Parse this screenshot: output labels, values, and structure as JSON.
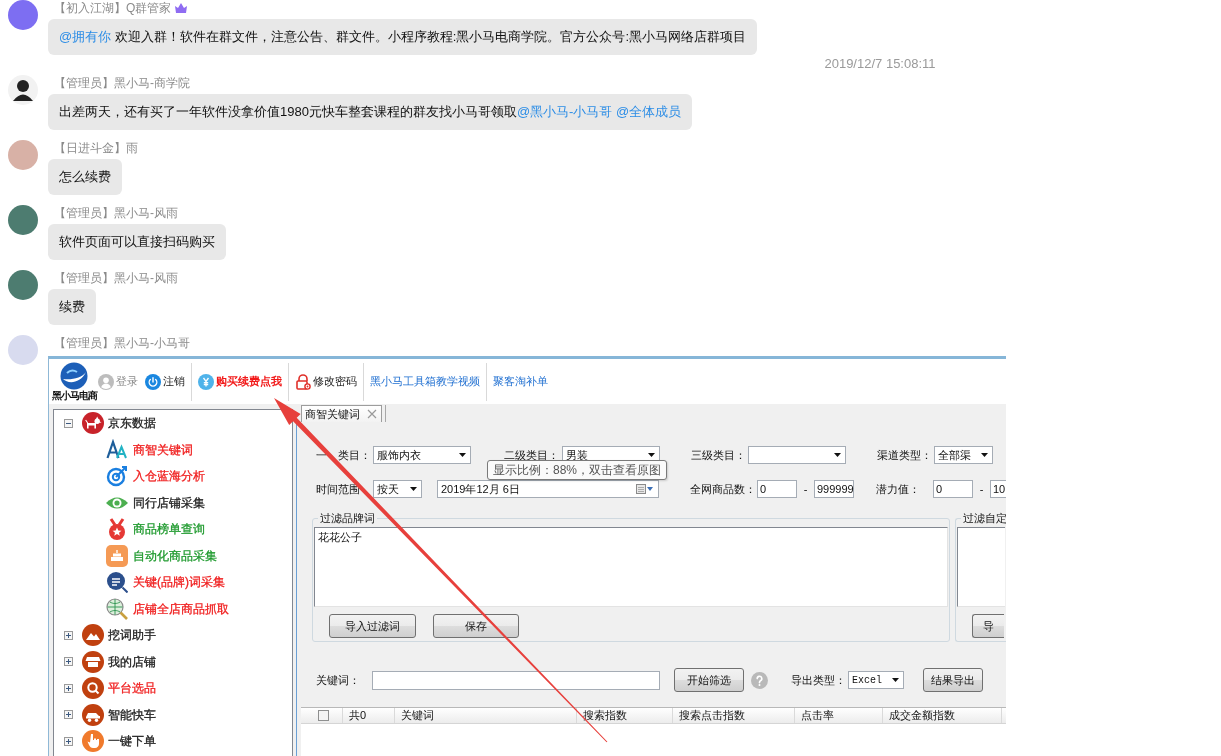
{
  "chat": [
    {
      "kind": "text",
      "sender": "【初入江湖】Q群管家",
      "badge": true,
      "parts": [
        {
          "kind": "mention",
          "text": "@拥有你"
        },
        {
          "kind": "plain",
          "text": "欢迎入群！软件在群文件，注意公告、群文件。小程序教程:黑小马电商学院。官方公众号:黑小马网络店群项目"
        }
      ]
    },
    {
      "kind": "time",
      "text": "2019/12/7 15:08:11"
    },
    {
      "kind": "text",
      "sender": "【管理员】黑小马-商学院",
      "badge": false,
      "parts": [
        {
          "kind": "plain",
          "text": "出差两天，还有买了一年软件没拿价值1980元快车整套课程的群友找小马哥领取"
        },
        {
          "kind": "mention",
          "text": "@黑小马-小马哥"
        },
        {
          "kind": "mention",
          "text": "@全体成员"
        }
      ]
    },
    {
      "kind": "text",
      "sender": "【日进斗金】雨",
      "badge": false,
      "parts": [
        {
          "kind": "plain",
          "text": "怎么续费"
        }
      ]
    },
    {
      "kind": "text",
      "sender": "【管理员】黑小马-风雨",
      "badge": false,
      "parts": [
        {
          "kind": "plain",
          "text": "软件页面可以直接扫码购买"
        }
      ]
    },
    {
      "kind": "text",
      "sender": "【管理员】黑小马-风雨",
      "badge": false,
      "parts": [
        {
          "kind": "plain",
          "text": "续费"
        }
      ]
    },
    {
      "kind": "image",
      "sender": "【管理员】黑小马-小马哥",
      "badge": false
    }
  ],
  "shared_image": {
    "logo_text": "黑小马电商",
    "toolbar": [
      [
        {
          "kind": "login",
          "label": "登录",
          "disabled": true
        },
        {
          "kind": "logout",
          "label": "注销",
          "disabled": false
        }
      ],
      [
        {
          "kind": "buy",
          "label": "购买续费点我",
          "disabled": false
        }
      ],
      [
        {
          "kind": "password",
          "label": "修改密码",
          "disabled": false
        }
      ],
      [
        {
          "kind": "link",
          "label": "黑小马工具箱教学视频",
          "disabled": false
        }
      ],
      [
        {
          "kind": "link",
          "label": "聚客淘补单",
          "disabled": false
        }
      ]
    ],
    "tree": [
      {
        "label": "京东数据",
        "color": "#222222",
        "expanded": true,
        "children": [
          {
            "label": "商智关键词",
            "color": "#f01e1e"
          },
          {
            "label": "入仓蓝海分析",
            "color": "#f01e1e"
          },
          {
            "label": "同行店铺采集",
            "color": "#222222"
          },
          {
            "label": "商品榜单查询",
            "color": "#1f9a2e"
          },
          {
            "label": "自动化商品采集",
            "color": "#1f9a2e"
          },
          {
            "label": "关键(品牌)词采集",
            "color": "#f01e1e"
          },
          {
            "label": "店铺全店商品抓取",
            "color": "#f01e1e"
          }
        ]
      },
      {
        "label": "挖词助手",
        "color": "#222222",
        "expanded": false
      },
      {
        "label": "我的店铺",
        "color": "#222222",
        "expanded": false
      },
      {
        "label": "平台选品",
        "color": "#f01e1e",
        "expanded": false
      },
      {
        "label": "智能快车",
        "color": "#222222",
        "expanded": false
      },
      {
        "label": "一键下单",
        "color": "#222222",
        "expanded": false
      }
    ],
    "tabs": [
      {
        "label": "商智关键词",
        "selected": true
      }
    ],
    "filter_rows": [
      [
        {
          "kind": "select",
          "label_parts": [
            "一",
            "类目："
          ],
          "value": "服饰内衣"
        },
        {
          "kind": "select",
          "label": "二级类目：",
          "value": "男装"
        },
        {
          "kind": "select",
          "label": "三级类目："
        },
        {
          "kind": "select",
          "label": "渠道类型：",
          "value": "全部渠"
        }
      ],
      [
        {
          "kind": "select",
          "label": "时间范围",
          "value": "按天"
        },
        {
          "kind": "date",
          "value": "2019年12月 6日"
        },
        {
          "kind": "range",
          "label": "全网商品数：",
          "from": "0",
          "separator": "-",
          "to": "999999"
        },
        {
          "kind": "range",
          "label": "潜力值：",
          "from": "0",
          "separator": "-",
          "to": "10"
        }
      ]
    ],
    "filter_groups": [
      {
        "title": "过滤品牌词",
        "value": "花花公子",
        "buttons": [
          "导入过滤词",
          "保存"
        ]
      },
      {
        "title": "过滤自定",
        "buttons": [
          "导"
        ]
      }
    ],
    "search": {
      "label": "关键词：",
      "button": "开始筛选",
      "export_label": "导出类型：",
      "export_value": "Excel",
      "export_button": "结果导出"
    },
    "table": {
      "header_checked": false,
      "columns": [
        "共0",
        "关键词",
        "搜索指数",
        "搜索点击指数",
        "点击率",
        "成交金额指数"
      ]
    },
    "tooltip": "显示比例：88%，双击查看原图"
  }
}
